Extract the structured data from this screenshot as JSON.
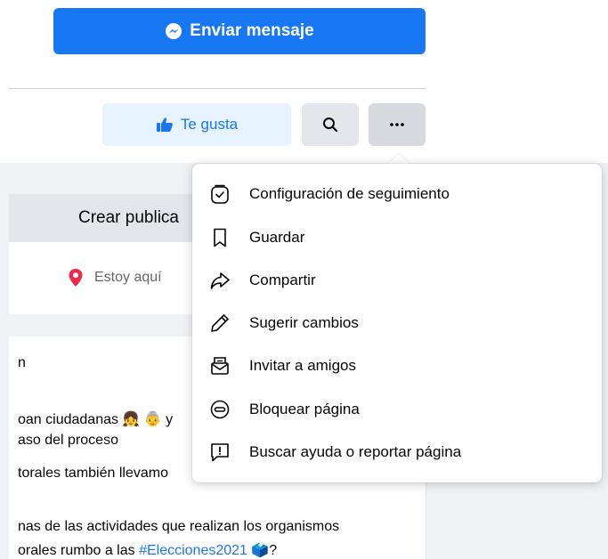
{
  "header": {
    "send_message_label": "Enviar mensaje",
    "like_label": "Te gusta"
  },
  "composer": {
    "create_post_label": "Crear publica",
    "checkin_label": "Estoy aquí"
  },
  "post": {
    "line1": "n",
    "line2a": "oan ciudadanas 👧 👵 y",
    "line3": "aso del proceso",
    "line4": "torales también llevamo",
    "line5": "nas de las actividades que realizan los organismos",
    "line6a": "orales rumbo a las ",
    "line6_hashtag": "#Elecciones2021",
    "line6b": " 🗳️?"
  },
  "menu": {
    "items": [
      {
        "label": "Configuración de seguimiento",
        "icon": "follow-settings-icon"
      },
      {
        "label": "Guardar",
        "icon": "bookmark-icon"
      },
      {
        "label": "Compartir",
        "icon": "share-icon"
      },
      {
        "label": "Sugerir cambios",
        "icon": "pencil-icon"
      },
      {
        "label": "Invitar a amigos",
        "icon": "invite-envelope-icon"
      },
      {
        "label": "Bloquear página",
        "icon": "block-icon"
      },
      {
        "label": "Buscar ayuda o reportar página",
        "icon": "report-icon"
      }
    ]
  },
  "colors": {
    "primary": "#1877f2",
    "like_bg": "#e7f3ff",
    "button_gray": "#e4e6eb",
    "feed_bg": "#f0f2f5",
    "checkin_pin": "#f02849"
  }
}
